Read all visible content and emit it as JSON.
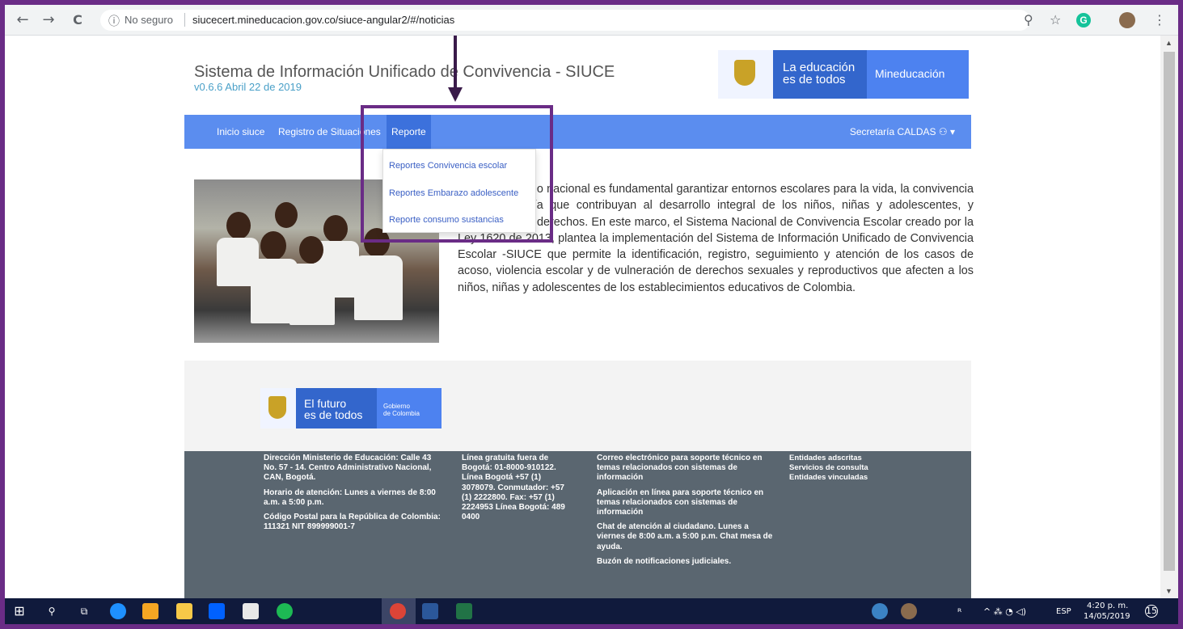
{
  "browser": {
    "security_label": "No seguro",
    "url": "siucecert.mineducacion.gov.co/siuce-angular2/#/noticias",
    "back_glyph": "←",
    "forward_glyph": "→",
    "reload_glyph": "C",
    "info_glyph": "ⓘ",
    "zoom_glyph": "⚲",
    "star_glyph": "☆",
    "ext_letter": "G",
    "menu_glyph": "⋮"
  },
  "header": {
    "title": "Sistema de Información Unificado de Convivencia - SIUCE",
    "version": "v0.6.6 Abril 22 de 2019",
    "brand_line1": "La educación",
    "brand_line2": "es de todos",
    "brand_ministry": "Mineducación"
  },
  "navbar": {
    "items": [
      "Inicio siuce",
      "Registro de Situaciones",
      "Reporte"
    ],
    "user": "Secretaría CALDAS ⚇ ▾"
  },
  "dropdown": {
    "items": [
      "Reportes Convivencia escolar",
      "Reportes Embarazo adolescente",
      "Reporte consumo sustancias"
    ]
  },
  "intro_text": "Para el gobierno nacional es fundamental garantizar entornos escolares para la vida, la convivencia y la ciudadanía que contribuyan al desarrollo integral de los niños, niñas y adolescentes, y garanticen sus derechos. En este marco, el Sistema Nacional de Convivencia Escolar creado por la Ley 1620 de 2013, plantea la implementación del Sistema de Información Unificado de Convivencia Escolar -SIUCE que permite la identificación, registro, seguimiento y atención de los casos de acoso, violencia escolar y de vulneración de derechos sexuales y reproductivos que afecten a los niños, niñas y adolescentes de los establecimientos educativos de Colombia.",
  "gov_logo": {
    "line1": "El futuro",
    "line2": "es de todos",
    "gov1": "Gobierno",
    "gov2": "de Colombia"
  },
  "footer": {
    "col1": [
      "Dirección Ministerio de Educación: Calle 43 No. 57 - 14. Centro Administrativo Nacional, CAN, Bogotá.",
      "Horario de atención: Lunes a viernes de 8:00 a.m. a 5:00 p.m.",
      "Código Postal para la República de Colombia: 111321 NIT 899999001-7"
    ],
    "col2": [
      "Línea gratuita fuera de Bogotá: 01-8000-910122. Línea Bogotá +57 (1) 3078079. Conmutador: +57 (1) 2222800. Fax: +57 (1) 2224953 Línea Bogotá: 489 0400"
    ],
    "col3": [
      "Correo electrónico para soporte técnico en temas relacionados con sistemas de información",
      "Aplicación en línea para soporte técnico en temas relacionados con sistemas de información",
      "Chat de atención al ciudadano. Lunes a viernes de 8:00 a.m. a 5:00 p.m. Chat mesa de ayuda.",
      "Buzón de notificaciones judiciales."
    ],
    "col4": [
      "Entidades adscritas",
      "Servicios de consulta",
      "Entidades vinculadas"
    ]
  },
  "taskbar": {
    "lang": "ESP",
    "time": "4:20 p. m.",
    "date": "14/05/2019",
    "notif_count": "15",
    "tray_glyphs": "^ ⁂ ◔ ◁)",
    "start_glyph": "⊞",
    "search_glyph": "⚲",
    "taskview_glyph": "⧉"
  }
}
